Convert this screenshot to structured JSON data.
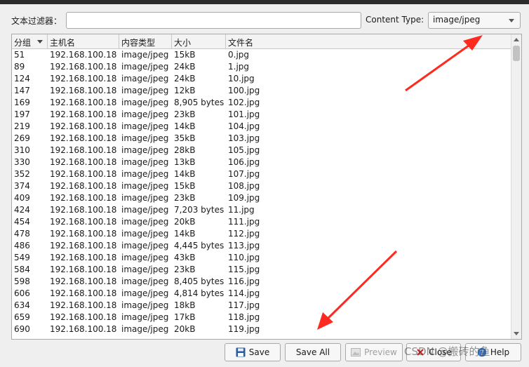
{
  "filter": {
    "label": "文本过滤器：",
    "value": ""
  },
  "content_type": {
    "label": "Content Type:",
    "selected": "image/jpeg"
  },
  "table": {
    "headers": [
      "分组",
      "主机名",
      "内容类型",
      "大小",
      "文件名"
    ],
    "rows": [
      [
        "51",
        "192.168.100.18",
        "image/jpeg",
        "15kB",
        "0.jpg"
      ],
      [
        "89",
        "192.168.100.18",
        "image/jpeg",
        "24kB",
        "1.jpg"
      ],
      [
        "124",
        "192.168.100.18",
        "image/jpeg",
        "24kB",
        "10.jpg"
      ],
      [
        "147",
        "192.168.100.18",
        "image/jpeg",
        "12kB",
        "100.jpg"
      ],
      [
        "169",
        "192.168.100.18",
        "image/jpeg",
        "8,905 bytes",
        "102.jpg"
      ],
      [
        "197",
        "192.168.100.18",
        "image/jpeg",
        "23kB",
        "101.jpg"
      ],
      [
        "219",
        "192.168.100.18",
        "image/jpeg",
        "14kB",
        "104.jpg"
      ],
      [
        "269",
        "192.168.100.18",
        "image/jpeg",
        "35kB",
        "103.jpg"
      ],
      [
        "310",
        "192.168.100.18",
        "image/jpeg",
        "28kB",
        "105.jpg"
      ],
      [
        "330",
        "192.168.100.18",
        "image/jpeg",
        "13kB",
        "106.jpg"
      ],
      [
        "352",
        "192.168.100.18",
        "image/jpeg",
        "14kB",
        "107.jpg"
      ],
      [
        "374",
        "192.168.100.18",
        "image/jpeg",
        "15kB",
        "108.jpg"
      ],
      [
        "409",
        "192.168.100.18",
        "image/jpeg",
        "23kB",
        "109.jpg"
      ],
      [
        "424",
        "192.168.100.18",
        "image/jpeg",
        "7,203 bytes",
        "11.jpg"
      ],
      [
        "454",
        "192.168.100.18",
        "image/jpeg",
        "20kB",
        "111.jpg"
      ],
      [
        "478",
        "192.168.100.18",
        "image/jpeg",
        "14kB",
        "112.jpg"
      ],
      [
        "486",
        "192.168.100.18",
        "image/jpeg",
        "4,445 bytes",
        "113.jpg"
      ],
      [
        "549",
        "192.168.100.18",
        "image/jpeg",
        "43kB",
        "110.jpg"
      ],
      [
        "584",
        "192.168.100.18",
        "image/jpeg",
        "23kB",
        "115.jpg"
      ],
      [
        "598",
        "192.168.100.18",
        "image/jpeg",
        "8,405 bytes",
        "116.jpg"
      ],
      [
        "606",
        "192.168.100.18",
        "image/jpeg",
        "4,814 bytes",
        "114.jpg"
      ],
      [
        "634",
        "192.168.100.18",
        "image/jpeg",
        "18kB",
        "117.jpg"
      ],
      [
        "659",
        "192.168.100.18",
        "image/jpeg",
        "17kB",
        "118.jpg"
      ],
      [
        "690",
        "192.168.100.18",
        "image/jpeg",
        "20kB",
        "119.jpg"
      ]
    ]
  },
  "buttons": {
    "save": "Save",
    "save_all": "Save All",
    "preview": "Preview",
    "close": "Close",
    "help": "Help"
  },
  "icons": {
    "save": "floppy-disk-icon",
    "preview": "image-icon",
    "close": "close-icon",
    "help": "help-icon"
  },
  "watermark": "CSDN @搬砖的鱼",
  "colors": {
    "annotation_arrow": "#ff2a1f",
    "save_icon": "#2c5aa0",
    "close_icon": "#d02020"
  }
}
